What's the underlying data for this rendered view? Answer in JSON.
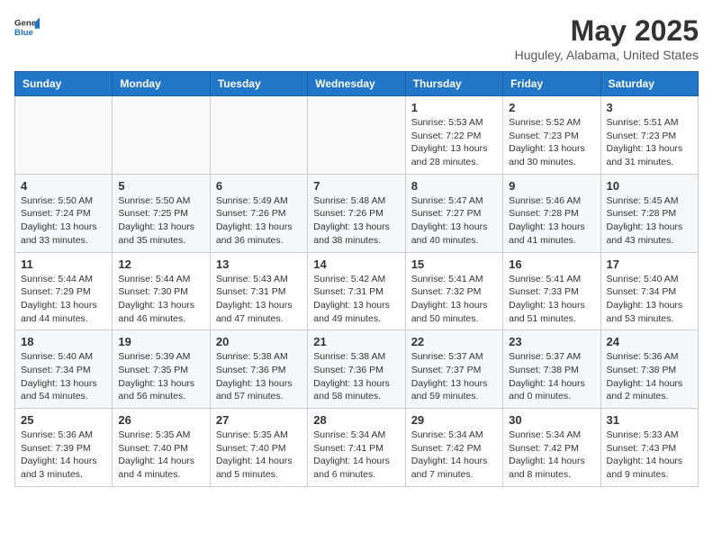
{
  "header": {
    "logo_general": "General",
    "logo_blue": "Blue",
    "month_title": "May 2025",
    "location": "Huguley, Alabama, United States"
  },
  "weekdays": [
    "Sunday",
    "Monday",
    "Tuesday",
    "Wednesday",
    "Thursday",
    "Friday",
    "Saturday"
  ],
  "weeks": [
    [
      {
        "day": "",
        "info": ""
      },
      {
        "day": "",
        "info": ""
      },
      {
        "day": "",
        "info": ""
      },
      {
        "day": "",
        "info": ""
      },
      {
        "day": "1",
        "info": "Sunrise: 5:53 AM\nSunset: 7:22 PM\nDaylight: 13 hours\nand 28 minutes."
      },
      {
        "day": "2",
        "info": "Sunrise: 5:52 AM\nSunset: 7:23 PM\nDaylight: 13 hours\nand 30 minutes."
      },
      {
        "day": "3",
        "info": "Sunrise: 5:51 AM\nSunset: 7:23 PM\nDaylight: 13 hours\nand 31 minutes."
      }
    ],
    [
      {
        "day": "4",
        "info": "Sunrise: 5:50 AM\nSunset: 7:24 PM\nDaylight: 13 hours\nand 33 minutes."
      },
      {
        "day": "5",
        "info": "Sunrise: 5:50 AM\nSunset: 7:25 PM\nDaylight: 13 hours\nand 35 minutes."
      },
      {
        "day": "6",
        "info": "Sunrise: 5:49 AM\nSunset: 7:26 PM\nDaylight: 13 hours\nand 36 minutes."
      },
      {
        "day": "7",
        "info": "Sunrise: 5:48 AM\nSunset: 7:26 PM\nDaylight: 13 hours\nand 38 minutes."
      },
      {
        "day": "8",
        "info": "Sunrise: 5:47 AM\nSunset: 7:27 PM\nDaylight: 13 hours\nand 40 minutes."
      },
      {
        "day": "9",
        "info": "Sunrise: 5:46 AM\nSunset: 7:28 PM\nDaylight: 13 hours\nand 41 minutes."
      },
      {
        "day": "10",
        "info": "Sunrise: 5:45 AM\nSunset: 7:28 PM\nDaylight: 13 hours\nand 43 minutes."
      }
    ],
    [
      {
        "day": "11",
        "info": "Sunrise: 5:44 AM\nSunset: 7:29 PM\nDaylight: 13 hours\nand 44 minutes."
      },
      {
        "day": "12",
        "info": "Sunrise: 5:44 AM\nSunset: 7:30 PM\nDaylight: 13 hours\nand 46 minutes."
      },
      {
        "day": "13",
        "info": "Sunrise: 5:43 AM\nSunset: 7:31 PM\nDaylight: 13 hours\nand 47 minutes."
      },
      {
        "day": "14",
        "info": "Sunrise: 5:42 AM\nSunset: 7:31 PM\nDaylight: 13 hours\nand 49 minutes."
      },
      {
        "day": "15",
        "info": "Sunrise: 5:41 AM\nSunset: 7:32 PM\nDaylight: 13 hours\nand 50 minutes."
      },
      {
        "day": "16",
        "info": "Sunrise: 5:41 AM\nSunset: 7:33 PM\nDaylight: 13 hours\nand 51 minutes."
      },
      {
        "day": "17",
        "info": "Sunrise: 5:40 AM\nSunset: 7:34 PM\nDaylight: 13 hours\nand 53 minutes."
      }
    ],
    [
      {
        "day": "18",
        "info": "Sunrise: 5:40 AM\nSunset: 7:34 PM\nDaylight: 13 hours\nand 54 minutes."
      },
      {
        "day": "19",
        "info": "Sunrise: 5:39 AM\nSunset: 7:35 PM\nDaylight: 13 hours\nand 56 minutes."
      },
      {
        "day": "20",
        "info": "Sunrise: 5:38 AM\nSunset: 7:36 PM\nDaylight: 13 hours\nand 57 minutes."
      },
      {
        "day": "21",
        "info": "Sunrise: 5:38 AM\nSunset: 7:36 PM\nDaylight: 13 hours\nand 58 minutes."
      },
      {
        "day": "22",
        "info": "Sunrise: 5:37 AM\nSunset: 7:37 PM\nDaylight: 13 hours\nand 59 minutes."
      },
      {
        "day": "23",
        "info": "Sunrise: 5:37 AM\nSunset: 7:38 PM\nDaylight: 14 hours\nand 0 minutes."
      },
      {
        "day": "24",
        "info": "Sunrise: 5:36 AM\nSunset: 7:38 PM\nDaylight: 14 hours\nand 2 minutes."
      }
    ],
    [
      {
        "day": "25",
        "info": "Sunrise: 5:36 AM\nSunset: 7:39 PM\nDaylight: 14 hours\nand 3 minutes."
      },
      {
        "day": "26",
        "info": "Sunrise: 5:35 AM\nSunset: 7:40 PM\nDaylight: 14 hours\nand 4 minutes."
      },
      {
        "day": "27",
        "info": "Sunrise: 5:35 AM\nSunset: 7:40 PM\nDaylight: 14 hours\nand 5 minutes."
      },
      {
        "day": "28",
        "info": "Sunrise: 5:34 AM\nSunset: 7:41 PM\nDaylight: 14 hours\nand 6 minutes."
      },
      {
        "day": "29",
        "info": "Sunrise: 5:34 AM\nSunset: 7:42 PM\nDaylight: 14 hours\nand 7 minutes."
      },
      {
        "day": "30",
        "info": "Sunrise: 5:34 AM\nSunset: 7:42 PM\nDaylight: 14 hours\nand 8 minutes."
      },
      {
        "day": "31",
        "info": "Sunrise: 5:33 AM\nSunset: 7:43 PM\nDaylight: 14 hours\nand 9 minutes."
      }
    ]
  ]
}
